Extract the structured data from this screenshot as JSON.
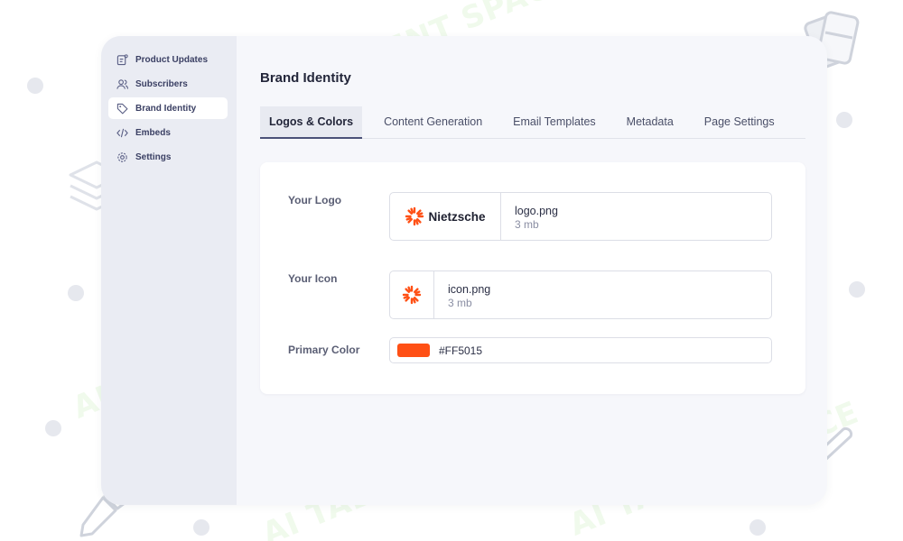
{
  "sidebar": {
    "items": [
      {
        "label": "Product Updates",
        "icon": "document-icon",
        "active": false
      },
      {
        "label": "Subscribers",
        "icon": "users-icon",
        "active": false
      },
      {
        "label": "Brand Identity",
        "icon": "tag-icon",
        "active": true
      },
      {
        "label": "Embeds",
        "icon": "code-icon",
        "active": false
      },
      {
        "label": "Settings",
        "icon": "gear-icon",
        "active": false
      }
    ]
  },
  "main": {
    "title": "Brand Identity",
    "tabs": [
      {
        "label": "Logos & Colors",
        "active": true
      },
      {
        "label": "Content Generation",
        "active": false
      },
      {
        "label": "Email Templates",
        "active": false
      },
      {
        "label": "Metadata",
        "active": false
      },
      {
        "label": "Page Settings",
        "active": false
      }
    ]
  },
  "form": {
    "logo": {
      "label": "Your Logo",
      "brand_text": "Nietzsche",
      "file_name": "logo.png",
      "file_size": "3 mb"
    },
    "icon": {
      "label": "Your Icon",
      "file_name": "icon.png",
      "file_size": "3 mb"
    },
    "color": {
      "label": "Primary Color",
      "value": "#FF5015"
    }
  },
  "watermark": {
    "text": "AI TALENT SPACE"
  },
  "colors": {
    "accent": "#FF5015",
    "sidebar_bg": "#eaecf3",
    "tab_indicator": "#4b5178"
  }
}
